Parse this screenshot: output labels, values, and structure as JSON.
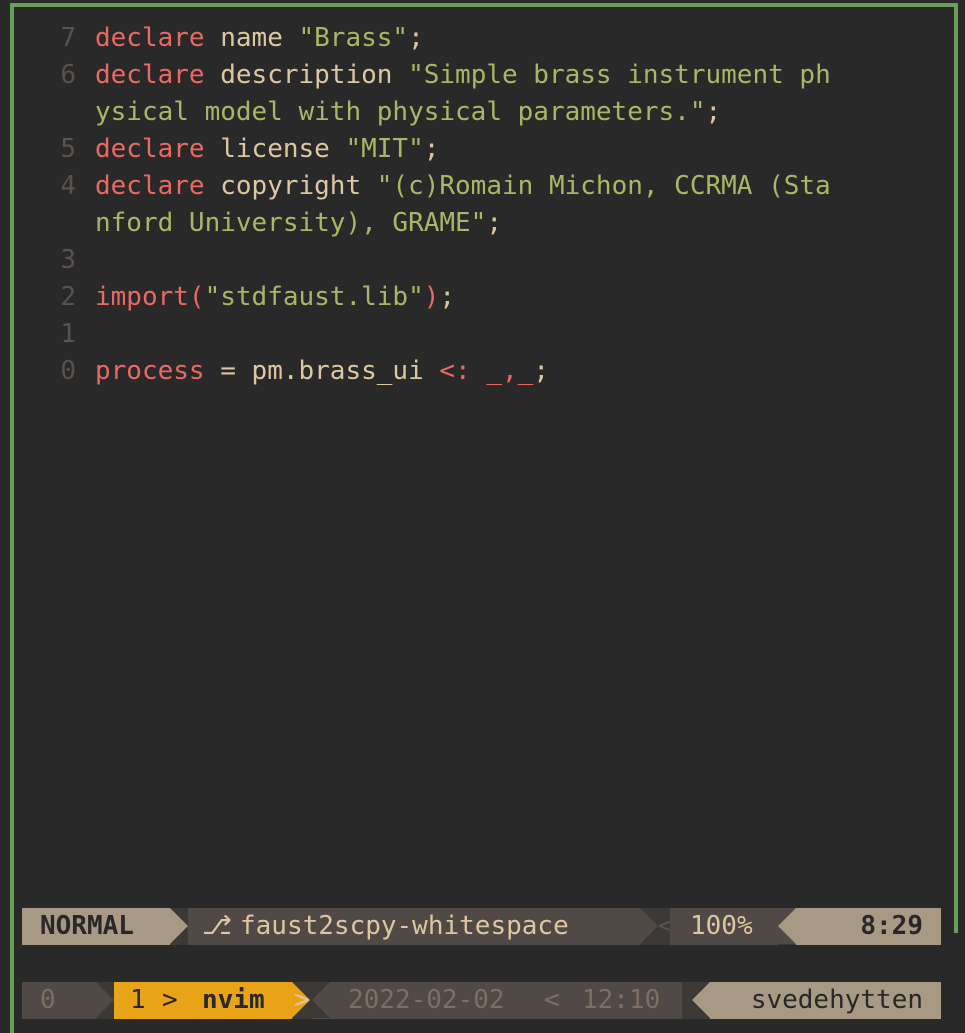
{
  "editor": {
    "lines": [
      {
        "num": "7",
        "segments": [
          [
            "kw",
            "declare"
          ],
          [
            "txt",
            " name "
          ],
          [
            "str",
            "\"Brass\""
          ],
          [
            "pn",
            ";"
          ]
        ]
      },
      {
        "num": "6",
        "segments": [
          [
            "kw",
            "declare"
          ],
          [
            "txt",
            " description "
          ],
          [
            "str",
            "\"Simple brass instrument ph"
          ]
        ]
      },
      {
        "num": "",
        "segments": [
          [
            "str",
            "ysical model with physical parameters.\""
          ],
          [
            "pn",
            ";"
          ]
        ]
      },
      {
        "num": "5",
        "segments": [
          [
            "kw",
            "declare"
          ],
          [
            "txt",
            " license "
          ],
          [
            "str",
            "\"MIT\""
          ],
          [
            "pn",
            ";"
          ]
        ]
      },
      {
        "num": "4",
        "segments": [
          [
            "kw",
            "declare"
          ],
          [
            "txt",
            " copyright "
          ],
          [
            "str",
            "\"(c)Romain Michon, CCRMA (Sta"
          ]
        ]
      },
      {
        "num": "",
        "segments": [
          [
            "str",
            "nford University), GRAME\""
          ],
          [
            "pn",
            ";"
          ]
        ]
      },
      {
        "num": "3",
        "segments": []
      },
      {
        "num": "2",
        "segments": [
          [
            "kw",
            "import"
          ],
          [
            "op",
            "("
          ],
          [
            "str",
            "\"stdfaust.lib\""
          ],
          [
            "op",
            ")"
          ],
          [
            "pn",
            ";"
          ]
        ]
      },
      {
        "num": "1",
        "segments": []
      },
      {
        "num": "0",
        "segments": [
          [
            "kw",
            "process"
          ],
          [
            "txt",
            " = pm.brass_ui "
          ],
          [
            "op",
            "<:"
          ],
          [
            "txt",
            " "
          ],
          [
            "op",
            "_,_"
          ],
          [
            "pn",
            ";"
          ]
        ]
      }
    ]
  },
  "statusline": {
    "mode": "NORMAL",
    "branch_icon": "git-branch-icon",
    "branch_glyph": "⎇",
    "branch": "faust2scpy-whitespace",
    "thin_sep": "<",
    "percent": "100%",
    "position": "8:29"
  },
  "tmux": {
    "session": "0",
    "window_index": "1",
    "window_sep": ">",
    "window_name": "nvim",
    "gt": ">",
    "date": "2022-02-02",
    "thin_sep": "<",
    "time": "12:10",
    "host": "svedehytten"
  },
  "colors": {
    "background": "#292929",
    "border": "#6b9e58",
    "keyword": "#ea6962",
    "string": "#a9b665",
    "text": "#ddc7a1",
    "accent": "#e8a317"
  }
}
